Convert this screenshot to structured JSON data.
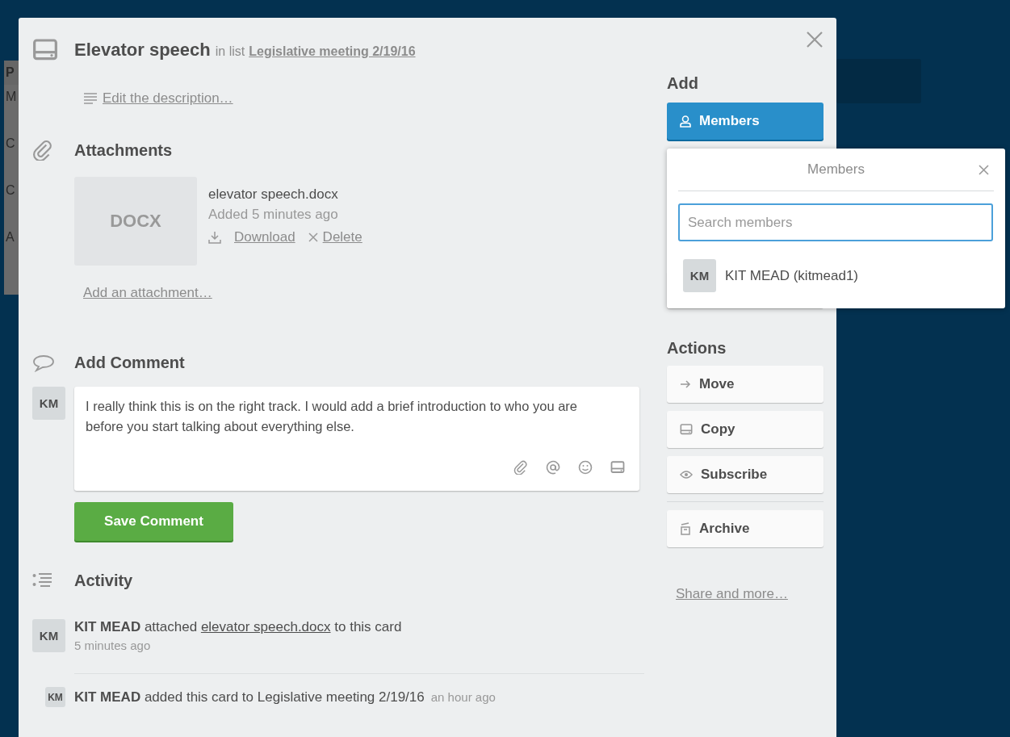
{
  "background_list": {
    "fragments": [
      "P",
      "M",
      "C",
      "C",
      "A"
    ]
  },
  "card": {
    "title": "Elevator speech",
    "in_list_label": "in list",
    "list_name": "Legislative meeting 2/19/16",
    "description_link": "Edit the description…"
  },
  "attachments": {
    "heading": "Attachments",
    "items": [
      {
        "thumb": "DOCX",
        "name": "elevator speech.docx",
        "added": "Added 5 minutes ago",
        "download": "Download",
        "delete": "Delete"
      }
    ],
    "add_link": "Add an attachment…"
  },
  "comment": {
    "heading": "Add Comment",
    "avatar": "KM",
    "value": "I really think this is on the right track. I would add a brief introduction to who you are before you start talking about everything else.",
    "save_button": "Save Comment"
  },
  "activity": {
    "heading": "Activity",
    "items": [
      {
        "kind": "attachment",
        "avatar": "KM",
        "actor": "KIT MEAD",
        "before": "attached",
        "link": "elevator speech.docx",
        "after": "to this card",
        "time": "5 minutes ago"
      },
      {
        "kind": "added",
        "avatar": "KM",
        "actor": "KIT MEAD",
        "text": "added this card to Legislative meeting 2/19/16",
        "time": "an hour ago"
      }
    ]
  },
  "sidebar": {
    "add_heading": "Add",
    "add_buttons": [
      {
        "label": "Members",
        "selected": true
      }
    ],
    "actions_heading": "Actions",
    "actions": [
      {
        "kind": "move",
        "label": "Move"
      },
      {
        "kind": "copy",
        "label": "Copy"
      },
      {
        "kind": "subscribe",
        "label": "Subscribe"
      },
      {
        "kind": "archive",
        "label": "Archive"
      }
    ],
    "share_link": "Share and more…"
  },
  "popup": {
    "title": "Members",
    "search_placeholder": "Search members",
    "members": [
      {
        "avatar": "KM",
        "name": "KIT MEAD (kitmead1)"
      }
    ]
  }
}
